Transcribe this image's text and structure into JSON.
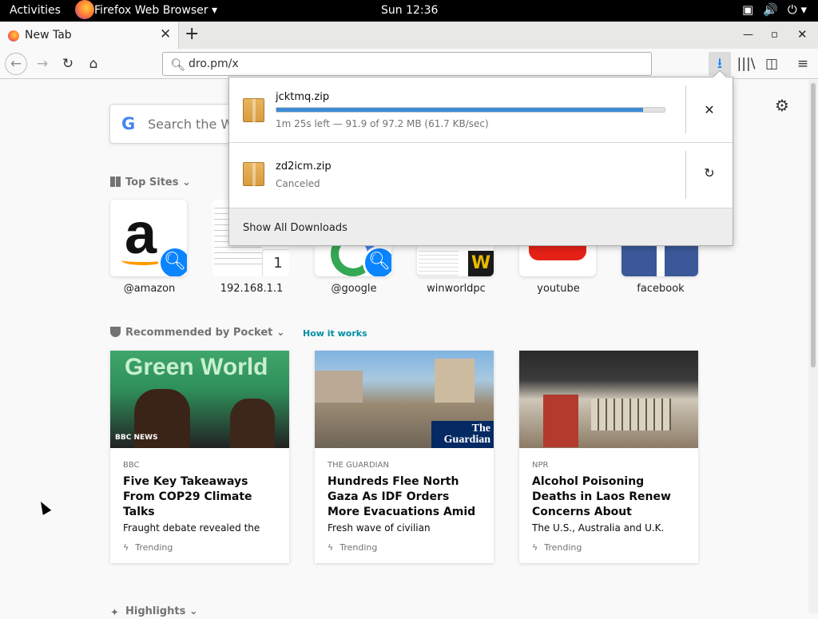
{
  "topbar": {
    "activities": "Activities",
    "app_menu": "Firefox Web Browser ▾",
    "clock": "Sun 12:36"
  },
  "tab": {
    "title": "New Tab"
  },
  "urlbar": {
    "value": "dro.pm/x"
  },
  "search": {
    "placeholder": "Search the W"
  },
  "sections": {
    "top_sites": "Top Sites",
    "pocket": "Recommended by Pocket",
    "how_it_works": "How it works",
    "highlights": "Highlights"
  },
  "top_sites": [
    {
      "name": "@amazon",
      "icon": "amazon-logo"
    },
    {
      "name": "192.168.1.1",
      "icon": "document-thumbnail"
    },
    {
      "name": "@google",
      "icon": "google-logo"
    },
    {
      "name": "winworldpc",
      "icon": "winworld-logo"
    },
    {
      "name": "youtube",
      "icon": "youtube-logo"
    },
    {
      "name": "facebook",
      "icon": "facebook-logo"
    }
  ],
  "cards": [
    {
      "source": "BBC",
      "title": "Five Key Takeaways From COP29 Climate Talks",
      "desc": "Fraught debate revealed the",
      "trend": "Trending",
      "img_text": "Green World",
      "img_brand": "BBC NEWS"
    },
    {
      "source": "THE GUARDIAN",
      "title": "Hundreds Flee North Gaza As IDF Orders More Evacuations Amid",
      "desc": "Fresh wave of civilian",
      "trend": "Trending",
      "img_brand": "The Guardian"
    },
    {
      "source": "NPR",
      "title": "Alcohol Poisoning Deaths in Laos Renew Concerns About",
      "desc": "The U.S., Australia and U.K.",
      "trend": "Trending"
    }
  ],
  "downloads": [
    {
      "filename": "jcktmq.zip",
      "status": "1m 25s left — 91.9 of 97.2 MB (61.7 KB/sec)",
      "progress": 0.945,
      "action": "cancel"
    },
    {
      "filename": "zd2icm.zip",
      "status": "Canceled",
      "action": "retry"
    }
  ],
  "footer": {
    "show_all": "Show All Downloads"
  },
  "colors": {
    "accent": "#0a84ff",
    "progress": "#3c8bd6"
  }
}
